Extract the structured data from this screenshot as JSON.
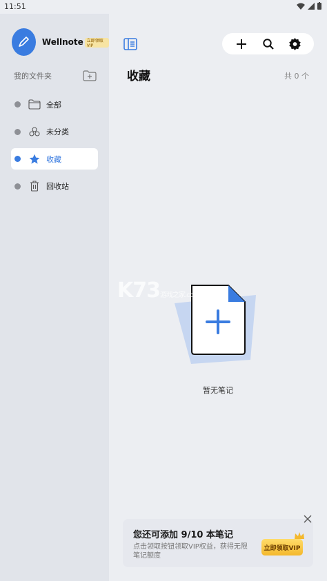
{
  "status_bar": {
    "time": "11:51",
    "icons": [
      "wifi-icon",
      "signal-icon",
      "battery-icon"
    ]
  },
  "app": {
    "name": "Wellnote",
    "vip_tag": "立即领取VIP",
    "accent": "#3a7ce0"
  },
  "sidebar": {
    "folder_label": "我的文件夹",
    "items": [
      {
        "label": "全部",
        "icon": "folder-icon",
        "active": false
      },
      {
        "label": "未分类",
        "icon": "uncategorized-icon",
        "active": false
      },
      {
        "label": "收藏",
        "icon": "star-icon",
        "active": true
      },
      {
        "label": "回收站",
        "icon": "trash-icon",
        "active": false
      }
    ]
  },
  "main": {
    "title": "收藏",
    "count": "共 0 个",
    "empty_text": "暂无笔记",
    "toolbar": [
      "add-icon",
      "search-icon",
      "settings-icon"
    ]
  },
  "watermark": {
    "big": "K73",
    "small1": "游戏之家",
    "small2": ".com"
  },
  "promo": {
    "title": "您还可添加 9/10 本笔记",
    "subtitle": "点击领取按钮领取VIP权益，获得无限笔记额度",
    "button": "立即领取VIP"
  }
}
